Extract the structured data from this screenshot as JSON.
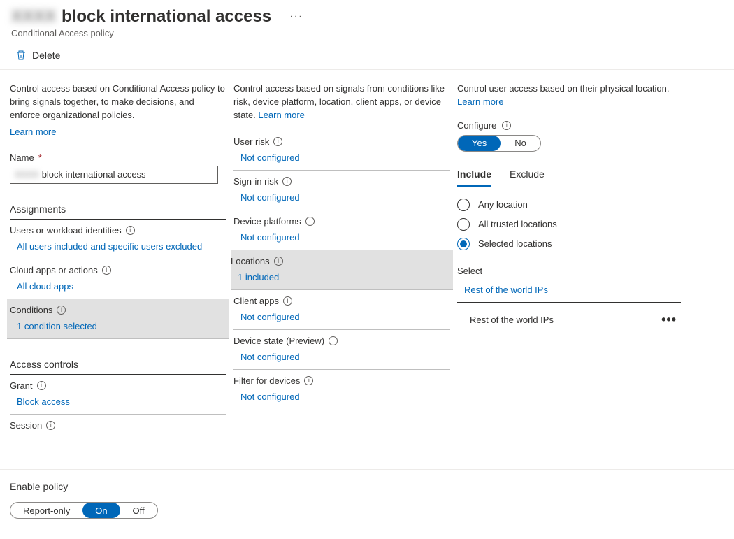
{
  "header": {
    "title_blur": "XXXX",
    "title_rest": "block international access",
    "subtitle": "Conditional Access policy",
    "more": "···"
  },
  "toolbar": {
    "delete": "Delete"
  },
  "col1": {
    "desc": "Control access based on Conditional Access policy to bring signals together, to make decisions, and enforce organizational policies.",
    "learn_more": "Learn more",
    "name_label": "Name",
    "name_blur": "XXXX",
    "name_value_rest": "block international access",
    "assignments_header": "Assignments",
    "users_label": "Users or workload identities",
    "users_value": "All users included and specific users excluded",
    "apps_label": "Cloud apps or actions",
    "apps_value": "All cloud apps",
    "conditions_label": "Conditions",
    "conditions_value": "1 condition selected",
    "controls_header": "Access controls",
    "grant_label": "Grant",
    "grant_value": "Block access",
    "session_label": "Session"
  },
  "col2": {
    "desc_a": "Control access based on signals from conditions like risk, device platform, location, client apps, or device state. ",
    "learn_more": "Learn more",
    "items": [
      {
        "label": "User risk",
        "value": "Not configured",
        "selected": false
      },
      {
        "label": "Sign-in risk",
        "value": "Not configured",
        "selected": false
      },
      {
        "label": "Device platforms",
        "value": "Not configured",
        "selected": false
      },
      {
        "label": "Locations",
        "value": "1 included",
        "selected": true
      },
      {
        "label": "Client apps",
        "value": "Not configured",
        "selected": false
      },
      {
        "label": "Device state (Preview)",
        "value": "Not configured",
        "selected": false
      },
      {
        "label": "Filter for devices",
        "value": "Not configured",
        "selected": false
      }
    ]
  },
  "col3": {
    "desc": "Control user access based on their physical location. ",
    "learn_more": "Learn more",
    "configure_label": "Configure",
    "yes": "Yes",
    "no": "No",
    "tab_include": "Include",
    "tab_exclude": "Exclude",
    "radio_any": "Any location",
    "radio_trusted": "All trusted locations",
    "radio_selected": "Selected locations",
    "select_label": "Select",
    "select_value": "Rest of the world IPs",
    "selected_item": "Rest of the world IPs"
  },
  "footer": {
    "label": "Enable policy",
    "report_only": "Report-only",
    "on": "On",
    "off": "Off"
  }
}
